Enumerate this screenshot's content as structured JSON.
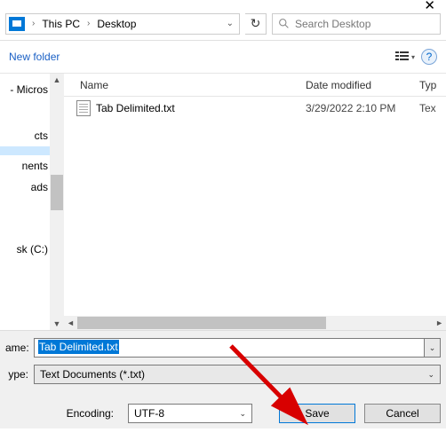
{
  "titlebar": {
    "close": "✕"
  },
  "breadcrumb": {
    "seg1": "This PC",
    "seg2": "Desktop"
  },
  "search": {
    "placeholder": "Search Desktop"
  },
  "toolbar": {
    "newfolder": "New folder"
  },
  "tree": {
    "items": [
      {
        "label": "- Micros"
      },
      {
        "label": "cts"
      },
      {
        "label": ""
      },
      {
        "label": "nents"
      },
      {
        "label": "ads"
      },
      {
        "label": ""
      },
      {
        "label": ""
      },
      {
        "label": "sk (C:)"
      }
    ]
  },
  "columns": {
    "name": "Name",
    "date": "Date modified",
    "type": "Typ"
  },
  "files": [
    {
      "name": "Tab Delimited.txt",
      "date": "3/29/2022 2:10 PM",
      "type": "Tex"
    }
  ],
  "form": {
    "name_label": "ame:",
    "name_value": "Tab Delimited.txt",
    "type_label": "ype:",
    "type_value": "Text Documents (*.txt)",
    "encoding_label": "Encoding:",
    "encoding_value": "UTF-8",
    "save": "Save",
    "cancel": "Cancel"
  }
}
